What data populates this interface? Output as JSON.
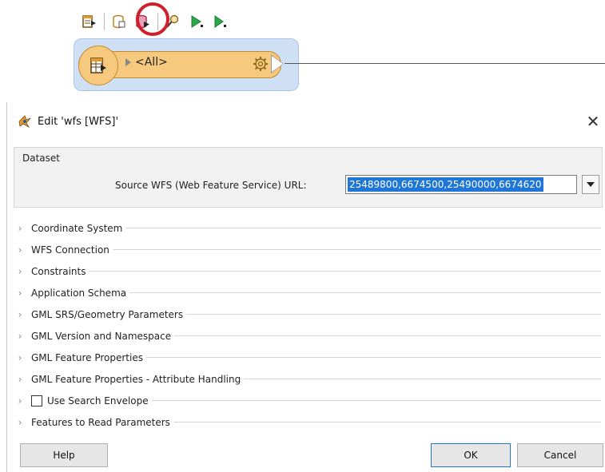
{
  "workbench": {
    "toolbar_icons": [
      "add-reader-icon",
      "database-icon",
      "database-edit-icon",
      "inspect-icon",
      "run-icon",
      "run-to-this-icon"
    ],
    "highlighted_icon": "database-edit-icon",
    "reader": {
      "port_label": "<All>",
      "colors": {
        "node_bg": "#f7c97e",
        "selection_bg": "#cfe0f5",
        "highlight_ring": "#d0202e"
      }
    }
  },
  "dialog": {
    "title": "Edit 'wfs [WFS]'",
    "close_glyph": "✕",
    "dataset": {
      "legend": "Dataset",
      "source_label": "Source WFS (Web Feature Service) URL:",
      "source_value": "25489800,6674500,25490000,6674620"
    },
    "sections": [
      {
        "label": "Coordinate System"
      },
      {
        "label": "WFS Connection"
      },
      {
        "label": "Constraints"
      },
      {
        "label": "Application Schema"
      },
      {
        "label": "GML SRS/Geometry Parameters"
      },
      {
        "label": "GML Version and Namespace"
      },
      {
        "label": "GML Feature Properties"
      },
      {
        "label": "GML Feature Properties - Attribute Handling"
      },
      {
        "label": "Use Search Envelope",
        "checkbox": true,
        "checked": false
      },
      {
        "label": "Features to Read Parameters"
      }
    ],
    "buttons": {
      "help": "Help",
      "ok": "OK",
      "cancel": "Cancel"
    },
    "colors": {
      "selection": "#1f76d6",
      "dataset_bg": "#f2f2f2"
    }
  }
}
